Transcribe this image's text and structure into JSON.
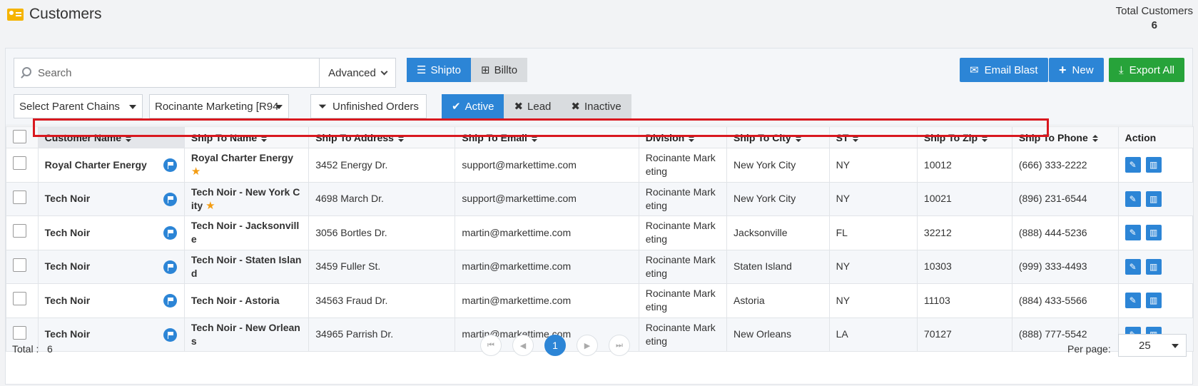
{
  "header": {
    "title": "Customers",
    "total_label": "Total Customers",
    "total_value": "6"
  },
  "toolbar": {
    "search_placeholder": "Search",
    "advanced_label": "Advanced",
    "shipto_label": "Shipto",
    "billto_label": "Billto",
    "email_blast_label": "Email Blast",
    "new_label": "New",
    "export_label": "Export All"
  },
  "filters": {
    "parent_chains": "Select Parent Chains",
    "rep": "Rocinante Marketing [R94",
    "unfinished_label": "Unfinished Orders",
    "status": [
      "Active",
      "Lead",
      "Inactive"
    ]
  },
  "table": {
    "headers": [
      "Customer Name",
      "Ship To Name",
      "Ship To Address",
      "Ship To Email",
      "Division",
      "Ship To City",
      "ST",
      "Ship To Zip",
      "Ship To Phone",
      "Action"
    ],
    "rows": [
      {
        "customer": "Royal Charter Energy",
        "ship_name": "Royal Charter Energy",
        "address": "3452 Energy Dr.",
        "email": "support@markettime.com",
        "division": "Rocinante Marketing",
        "city": "New York City",
        "st": "NY",
        "zip": "10012",
        "phone": "(666) 333-2222"
      },
      {
        "customer": "Tech Noir",
        "ship_name": "Tech Noir - New York City",
        "address": "4698 March Dr.",
        "email": "support@markettime.com",
        "division": "Rocinante Marketing",
        "city": "New York City",
        "st": "NY",
        "zip": "10021",
        "phone": "(896) 231-6544"
      },
      {
        "customer": "Tech Noir",
        "ship_name": "Tech Noir - Jacksonville",
        "address": "3056 Bortles Dr.",
        "email": "martin@markettime.com",
        "division": "Rocinante Marketing",
        "city": "Jacksonville",
        "st": "FL",
        "zip": "32212",
        "phone": "(888) 444-5236"
      },
      {
        "customer": "Tech Noir",
        "ship_name": "Tech Noir - Staten Island",
        "address": "3459 Fuller St.",
        "email": "martin@markettime.com",
        "division": "Rocinante Marketing",
        "city": "Staten Island",
        "st": "NY",
        "zip": "10303",
        "phone": "(999) 333-4493"
      },
      {
        "customer": "Tech Noir",
        "ship_name": "Tech Noir - Astoria",
        "address": "34563 Fraud Dr.",
        "email": "martin@markettime.com",
        "division": "Rocinante Marketing",
        "city": "Astoria",
        "st": "NY",
        "zip": "11103",
        "phone": "(884) 433-5566"
      },
      {
        "customer": "Tech Noir",
        "ship_name": "Tech Noir - New Orleans",
        "address": "34965 Parrish Dr.",
        "email": "martin@markettime.com",
        "division": "Rocinante Marketing",
        "city": "New Orleans",
        "st": "LA",
        "zip": "70127",
        "phone": "(888) 777-5542"
      }
    ]
  },
  "footer": {
    "total_label": "Total :",
    "total_value": "6",
    "current_page": "1",
    "per_page_label": "Per page:",
    "per_page_value": "25"
  }
}
